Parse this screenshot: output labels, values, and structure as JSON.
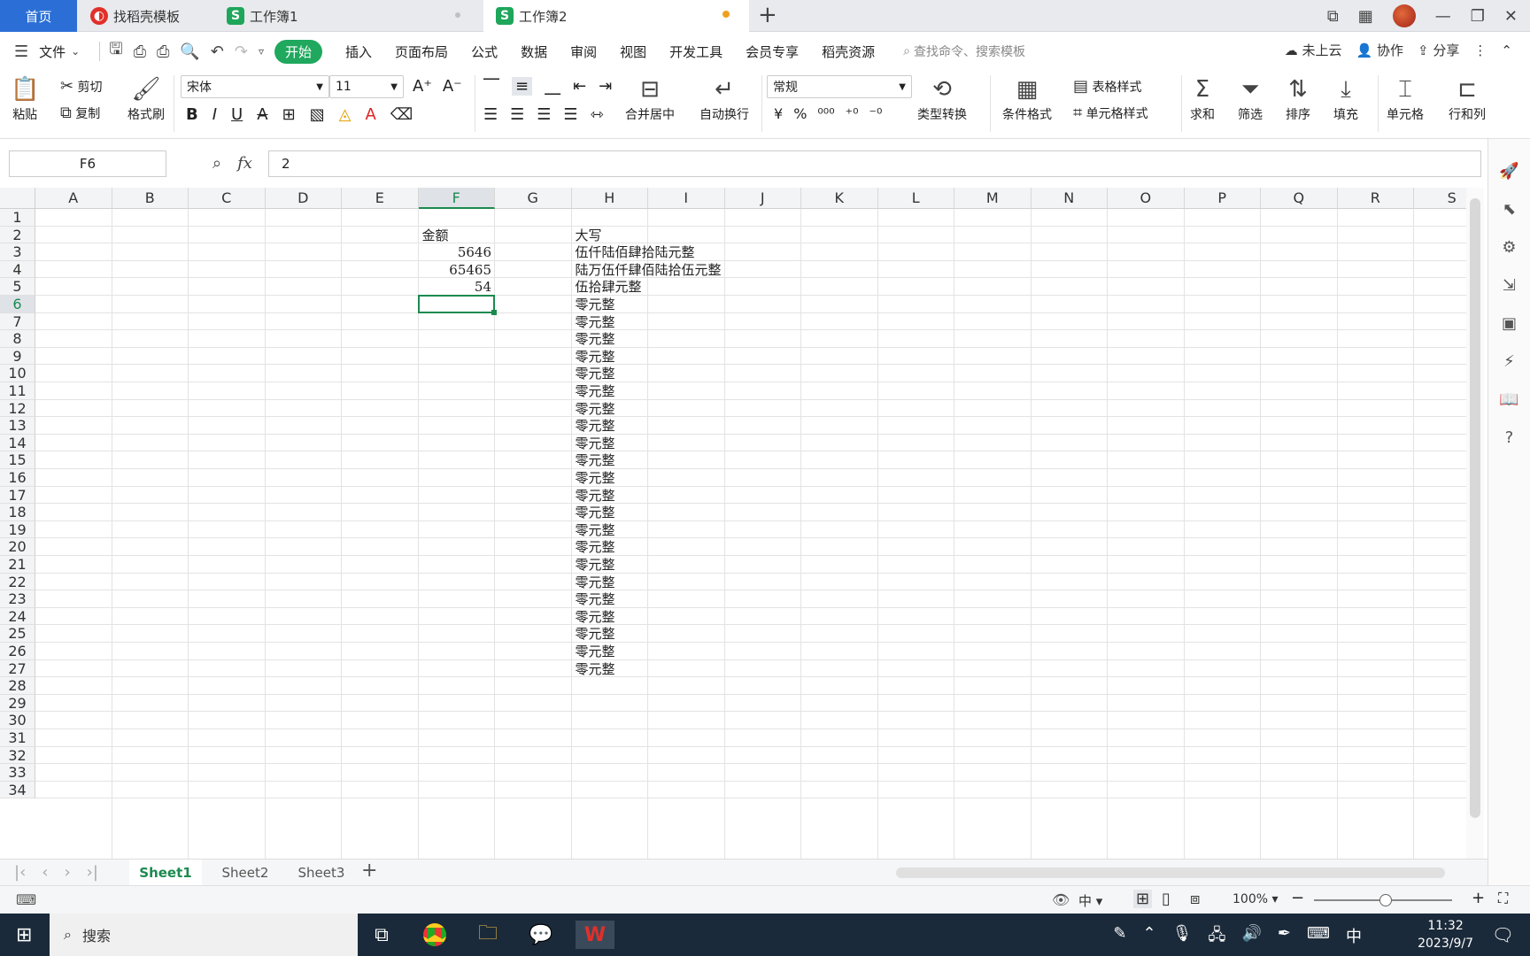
{
  "tabs": {
    "home": "首页",
    "templates": "找稻壳模板",
    "workbook1": "工作簿1",
    "workbook2": "工作簿2",
    "add": "+"
  },
  "menu": {
    "file": "文件",
    "items": [
      "开始",
      "插入",
      "页面布局",
      "公式",
      "数据",
      "审阅",
      "视图",
      "开发工具",
      "会员专享",
      "稻壳资源"
    ],
    "search_placeholder": "查找命令、搜索模板",
    "cloud": "未上云",
    "collab": "协作",
    "share": "分享"
  },
  "ribbon": {
    "paste": "粘贴",
    "cut": "剪切",
    "copy": "复制",
    "format_painter": "格式刷",
    "font_name": "宋体",
    "font_size": "11",
    "merge_center": "合并居中",
    "wrap_text": "自动换行",
    "number_format": "常规",
    "type_convert": "类型转换",
    "conditional_format": "条件格式",
    "table_style": "表格样式",
    "cell_style": "单元格样式",
    "sum": "求和",
    "filter": "筛选",
    "sort": "排序",
    "fill": "填充",
    "cell": "单元格",
    "row_col": "行和列"
  },
  "formula_bar": {
    "name_box": "F6",
    "formula": "2"
  },
  "grid": {
    "columns": [
      "A",
      "B",
      "C",
      "D",
      "E",
      "F",
      "G",
      "H",
      "I",
      "J",
      "K",
      "L",
      "M",
      "N",
      "O",
      "P",
      "Q",
      "R",
      "S"
    ],
    "selected_column": "F",
    "selected_row": 6,
    "rows": [
      "1",
      "2",
      "3",
      "4",
      "5",
      "6",
      "7",
      "8",
      "9",
      "10",
      "11",
      "12",
      "13",
      "14",
      "15",
      "16",
      "17",
      "18",
      "19",
      "20",
      "21",
      "22",
      "23",
      "24",
      "25",
      "26",
      "27",
      "28",
      "29",
      "30",
      "31",
      "32",
      "33",
      "34"
    ],
    "f_header": "金额",
    "h_header": "大写",
    "amounts": [
      "5646",
      "65465",
      "54"
    ],
    "uppercase": [
      "伍仟陆佰肆拾陆元整",
      "陆万伍仟肆佰陆拾伍元整",
      "伍拾肆元整",
      "零元整",
      "零元整",
      "零元整",
      "零元整",
      "零元整",
      "零元整",
      "零元整",
      "零元整",
      "零元整",
      "零元整",
      "零元整",
      "零元整",
      "零元整",
      "零元整",
      "零元整",
      "零元整",
      "零元整",
      "零元整",
      "零元整",
      "零元整",
      "零元整",
      "零元整"
    ]
  },
  "sheets": [
    "Sheet1",
    "Sheet2",
    "Sheet3"
  ],
  "active_sheet": "Sheet1",
  "status": {
    "zoom": "100%",
    "input_mode": "中"
  },
  "taskbar": {
    "search": "搜索",
    "time": "11:32",
    "date": "2023/9/7",
    "ime": "中"
  },
  "colors": {
    "accent": "#1c8a4f",
    "home_tab": "#2b6fd6",
    "modified_dot": "#f0a020"
  }
}
